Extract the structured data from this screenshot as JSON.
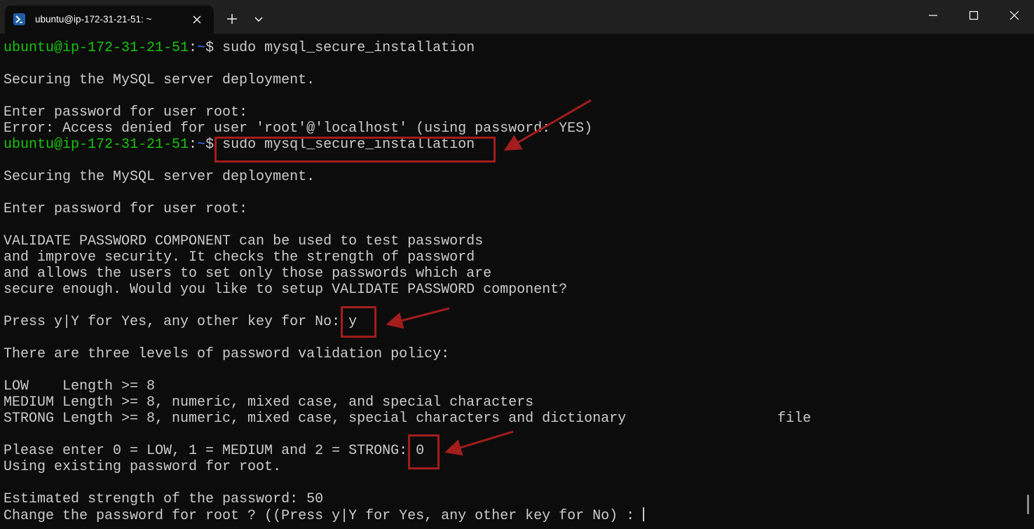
{
  "window": {
    "tab_title": "ubuntu@ip-172-31-21-51: ~",
    "icons": {
      "tab": "powershell-terminal-icon",
      "close_tab": "close-icon",
      "new_tab": "plus-icon",
      "tab_menu": "chevron-down-icon",
      "minimize": "minimize-icon",
      "maximize": "maximize-icon",
      "close_window": "close-icon"
    }
  },
  "terminal": {
    "prompt_user_host": "ubuntu@ip-172-31-21-51",
    "prompt_colon": ":",
    "prompt_path": "~",
    "prompt_dollar": "$ ",
    "command_1": "sudo mysql_secure_installation",
    "line_securing_1": "Securing the MySQL server deployment.",
    "line_enter_pw_1": "Enter password for user root:",
    "line_error": "Error: Access denied for user 'root'@'localhost' (using password: YES)",
    "command_2": "sudo mysql_secure_installation",
    "line_securing_2": "Securing the MySQL server deployment.",
    "line_enter_pw_2": "Enter password for user root:",
    "validate_1": "VALIDATE PASSWORD COMPONENT can be used to test passwords",
    "validate_2": "and improve security. It checks the strength of password",
    "validate_3": "and allows the users to set only those passwords which are",
    "validate_4": "secure enough. Would you like to setup VALIDATE PASSWORD component?",
    "press_prompt": "Press y|Y for Yes, any other key for No: ",
    "press_answer": "y",
    "levels_intro": "There are three levels of password validation policy:",
    "level_low": "LOW    Length >= 8",
    "level_medium": "MEDIUM Length >= 8, numeric, mixed case, and special characters",
    "level_strong": "STRONG Length >= 8, numeric, mixed case, special characters and dictionary",
    "level_strong_file": "file",
    "level_prompt": "Please enter 0 = LOW, 1 = MEDIUM and 2 = STRONG: ",
    "level_answer": "0",
    "using_existing": "Using existing password for root.",
    "estimated_strength": "Estimated strength of the password: 50",
    "change_prompt": "Change the password for root ? ((Press y|Y for Yes, any other key for No) : "
  },
  "colors": {
    "background": "#0c0c0c",
    "titlebar": "#202020",
    "text": "#cccccc",
    "prompt_green": "#16c60c",
    "prompt_blue": "#3b78ff",
    "annotation_red": "#a31d1d"
  }
}
